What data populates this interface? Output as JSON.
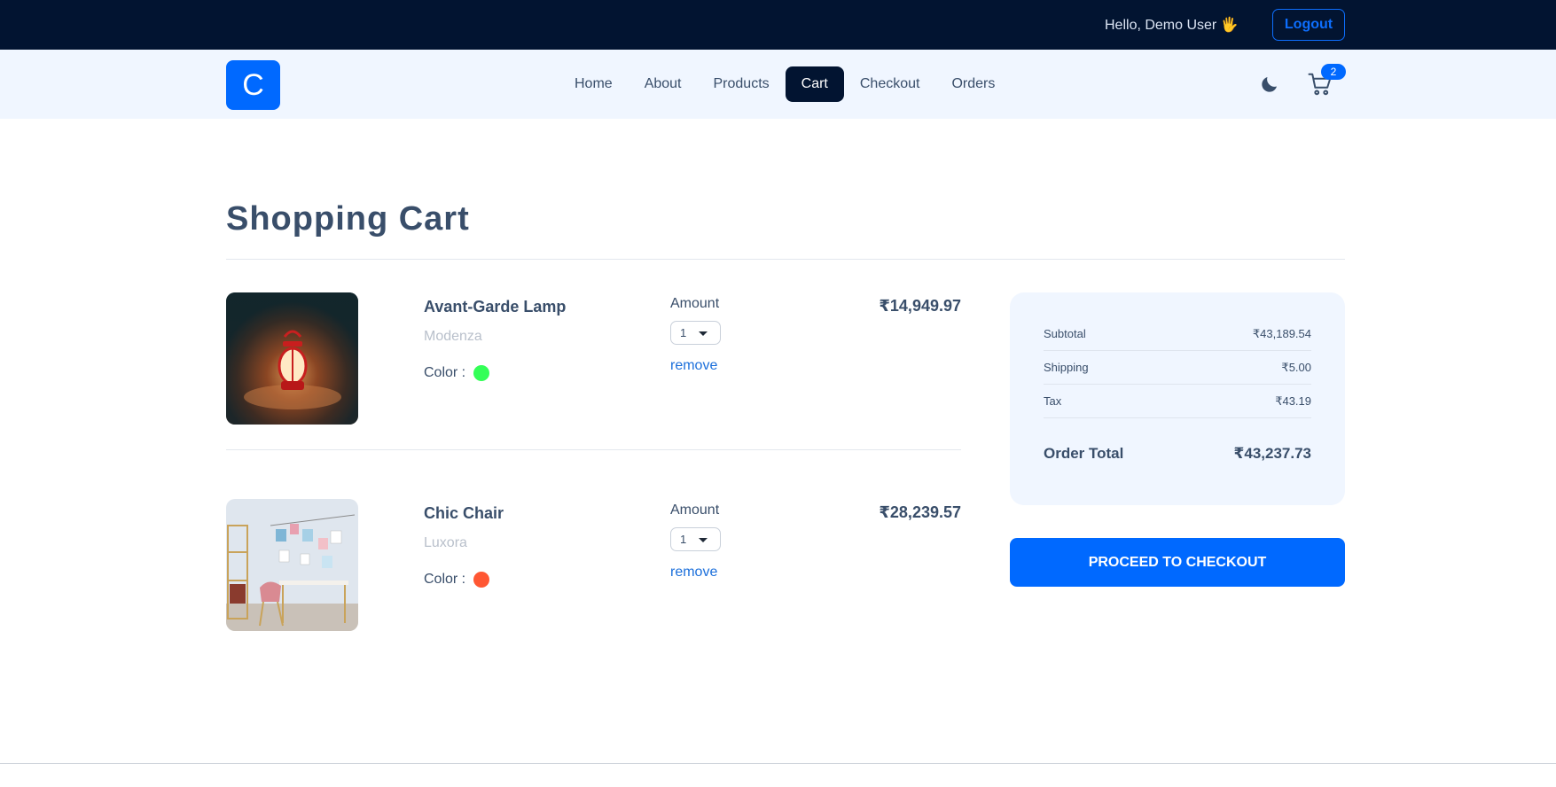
{
  "topbar": {
    "greeting": "Hello, Demo User",
    "wave": "🖐",
    "logout_label": "Logout"
  },
  "navbar": {
    "logo_letter": "C",
    "links": [
      "Home",
      "About",
      "Products",
      "Cart",
      "Checkout",
      "Orders"
    ],
    "active_link": "Cart",
    "theme_icon": "moon-icon",
    "cart_icon": "cart-icon",
    "cart_count": "2"
  },
  "page": {
    "title": "Shopping Cart"
  },
  "cart": {
    "items": [
      {
        "name": "Avant-Garde Lamp",
        "company": "Modenza",
        "color_label": "Color :",
        "color": "#33ff57",
        "amount_label": "Amount",
        "amount": "1",
        "remove_label": "remove",
        "price": "₹14,949.97"
      },
      {
        "name": "Chic Chair",
        "company": "Luxora",
        "color_label": "Color :",
        "color": "#ff5733",
        "amount_label": "Amount",
        "amount": "1",
        "remove_label": "remove",
        "price": "₹28,239.57"
      }
    ]
  },
  "summary": {
    "subtotal_label": "Subtotal",
    "subtotal": "₹43,189.54",
    "shipping_label": "Shipping",
    "shipping": "₹5.00",
    "tax_label": "Tax",
    "tax": "₹43.19",
    "total_label": "Order Total",
    "total": "₹43,237.73"
  },
  "checkout_label": "PROCEED TO CHECKOUT",
  "colors": {
    "primary": "#0069ff",
    "dark": "#021431",
    "nav_bg": "#f0f6ff"
  }
}
